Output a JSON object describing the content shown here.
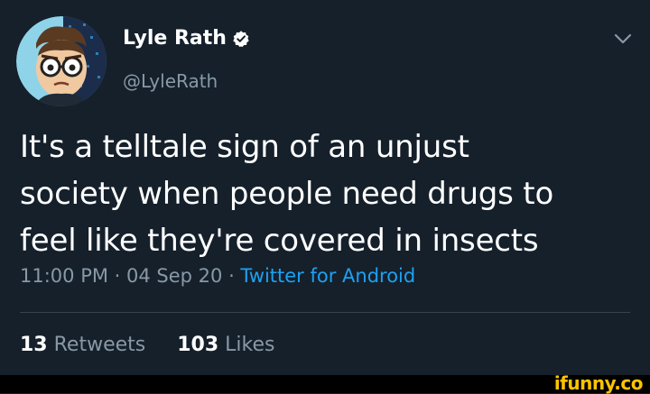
{
  "tweet": {
    "author": {
      "name": "Lyle Rath",
      "handle": "@LyleRath",
      "verified": true
    },
    "text_lines": [
      "It's a telltale sign of an unjust",
      "society when people need drugs to",
      "feel like they're covered in insects"
    ],
    "time": "11:00 PM",
    "date": "04 Sep 20",
    "separator": " · ",
    "source": "Twitter for Android",
    "retweets": {
      "count": "13",
      "label": "Retweets"
    },
    "likes": {
      "count": "103",
      "label": "Likes"
    }
  },
  "watermark": "ifunny.co",
  "colors": {
    "background": "#15202b",
    "text": "#ffffff",
    "muted": "#8899a6",
    "link": "#1da1f2",
    "watermark": "#ffc300"
  },
  "icons": {
    "verified": "verified-badge-icon",
    "menu": "chevron-down-icon"
  }
}
